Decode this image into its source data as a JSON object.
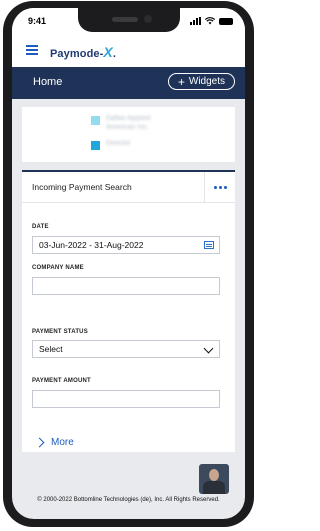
{
  "status": {
    "time": "9:41"
  },
  "app": {
    "logo_text": "Paymode-",
    "logo_x": "X",
    "logo_dot": "."
  },
  "nav": {
    "title": "Home",
    "widgets_label": "Widgets",
    "widgets_plus": "+"
  },
  "legend": {
    "items": [
      {
        "color": "#93dbef",
        "text": "Dallas Applied American Inc."
      },
      {
        "color": "#1ea8dc",
        "text": "Director"
      }
    ]
  },
  "search": {
    "title": "Incoming Payment Search",
    "date_label": "DATE",
    "date_value": "03-Jun-2022 - 31-Aug-2022",
    "company_label": "COMPANY NAME",
    "company_value": "",
    "status_label": "PAYMENT STATUS",
    "status_value": "Select",
    "amount_label": "PAYMENT AMOUNT",
    "amount_value": "",
    "more_label": "More"
  },
  "footer": {
    "copyright": "© 2000-2022 Bottomline Technologies (de), Inc. All Rights Reserved."
  },
  "colors": {
    "navy": "#1e3357",
    "accent": "#1e5bbf",
    "logo_x": "#2fa4d9"
  }
}
